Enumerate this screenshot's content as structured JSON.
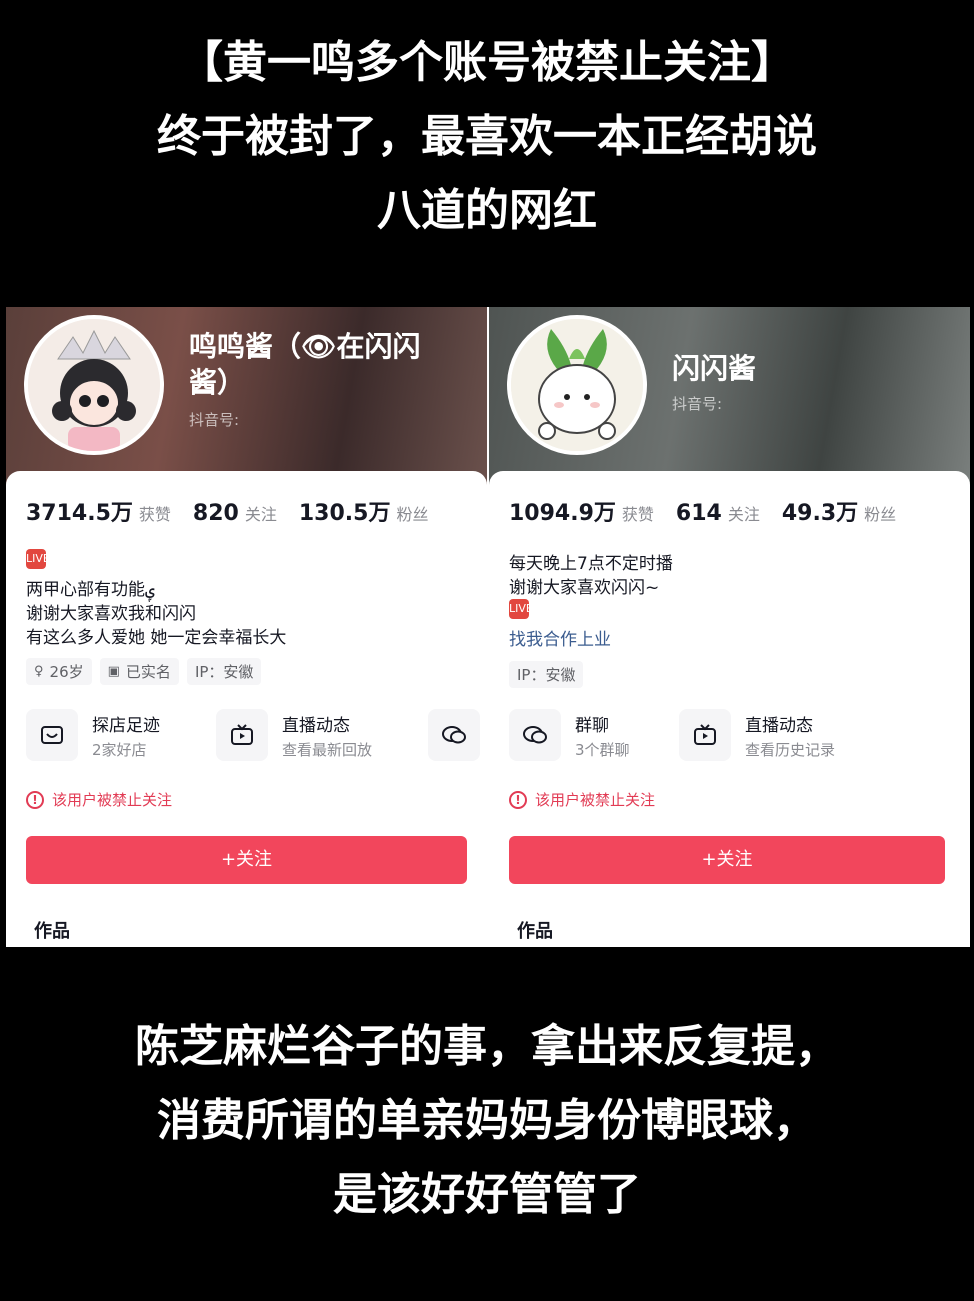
{
  "top_caption": {
    "lines": [
      "【黄一鸣多个账号被禁止关注】",
      "终于被封了，最喜欢一本正经胡说",
      "八道的网红"
    ]
  },
  "bottom_caption": {
    "lines": [
      "陈芝麻烂谷子的事，拿出来反复提，",
      "消费所谓的单亲妈妈身份博眼球，",
      "是该好好管管了"
    ]
  },
  "profiles": [
    {
      "name": "鸣鸣酱（👁在闪闪酱）",
      "douyin_id_label": "抖音号:",
      "stats": [
        {
          "value": "3714.5万",
          "label": "获赞"
        },
        {
          "value": "820",
          "label": "关注"
        },
        {
          "value": "130.5万",
          "label": "粉丝"
        }
      ],
      "bio_tag": "LIVE",
      "bio": [
        "两甲心部有功能ݷ",
        "谢谢大家喜欢我和闪闪",
        "有这么多人爱她 她一定会幸福长大"
      ],
      "pills": [
        {
          "icon": "gender-icon",
          "text": "26岁"
        },
        {
          "icon": "id-card-icon",
          "text": "已实名"
        },
        {
          "icon": "",
          "text": "IP：安徽"
        }
      ],
      "entries": [
        {
          "icon": "store-icon",
          "title": "探店足迹",
          "sub": "2家好店"
        },
        {
          "icon": "tv-icon",
          "title": "直播动态",
          "sub": "查看最新回放"
        },
        {
          "icon": "chat-icon",
          "title": "",
          "sub": ""
        }
      ],
      "warning": "该用户被禁止关注",
      "follow_button": "+关注",
      "works_tab": "作品",
      "colors": {
        "accent": "#f2465c",
        "warning": "#e23b54"
      }
    },
    {
      "name": "闪闪酱",
      "douyin_id_label": "抖音号:",
      "stats": [
        {
          "value": "1094.9万",
          "label": "获赞"
        },
        {
          "value": "614",
          "label": "关注"
        },
        {
          "value": "49.3万",
          "label": "粉丝"
        }
      ],
      "bio": [
        "每天晚上7点不定时播",
        "谢谢大家喜欢闪闪~"
      ],
      "bio_tag": "LIVE",
      "link_text": "找我合作上业",
      "pills": [
        {
          "icon": "",
          "text": "IP：安徽"
        }
      ],
      "entries": [
        {
          "icon": "chat-icon",
          "title": "群聊",
          "sub": "3个群聊"
        },
        {
          "icon": "tv-icon",
          "title": "直播动态",
          "sub": "查看历史记录"
        }
      ],
      "warning": "该用户被禁止关注",
      "follow_button": "+关注",
      "works_tab": "作品",
      "colors": {
        "accent": "#f2465c",
        "warning": "#e23b54"
      }
    }
  ]
}
